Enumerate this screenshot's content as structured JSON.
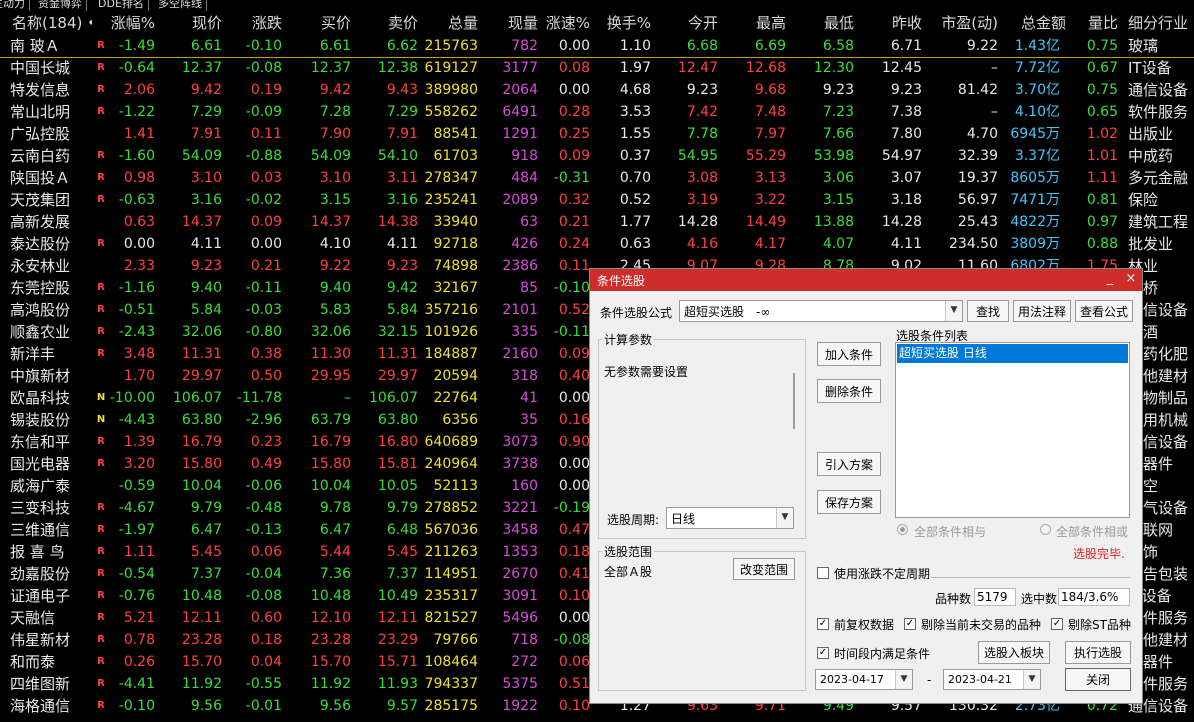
{
  "top_tabs": [
    "主动力",
    "资金博弈",
    "DDE排名",
    "多空阵线"
  ],
  "columns": [
    "名称(184) •",
    "涨幅%",
    "现价",
    "涨跌",
    "买价",
    "卖价",
    "总量",
    "现量",
    "涨速%",
    "换手%",
    "今开",
    "最高",
    "最低",
    "昨收",
    "市盈(动)",
    "总金额",
    "量比",
    "细分行业"
  ],
  "rows": [
    [
      "南 玻Ａ",
      "R",
      "-1.49",
      "6.61",
      "-0.10",
      "6.61",
      "6.62",
      "215763",
      "782",
      "0.00",
      "1.10",
      "6.68",
      "6.69",
      "6.58",
      "6.71",
      "9.22",
      "1.43",
      "亿",
      "0.75",
      "玻璃"
    ],
    [
      "中国长城",
      "R",
      "-0.64",
      "12.37",
      "-0.08",
      "12.37",
      "12.38",
      "619127",
      "3177",
      "0.08",
      "1.97",
      "12.47",
      "12.68",
      "12.30",
      "12.45",
      "–",
      "7.72",
      "亿",
      "0.67",
      "IT设备"
    ],
    [
      "特发信息",
      "R",
      "2.06",
      "9.42",
      "0.19",
      "9.42",
      "9.43",
      "389980",
      "2064",
      "0.00",
      "4.68",
      "9.23",
      "9.68",
      "9.23",
      "9.23",
      "81.42",
      "3.70",
      "亿",
      "0.75",
      "通信设备"
    ],
    [
      "常山北明",
      "R",
      "-1.22",
      "7.29",
      "-0.09",
      "7.28",
      "7.29",
      "558262",
      "6491",
      "0.28",
      "3.53",
      "7.42",
      "7.48",
      "7.23",
      "7.38",
      "–",
      "4.10",
      "亿",
      "0.65",
      "软件服务"
    ],
    [
      "广弘控股",
      "",
      "1.41",
      "7.91",
      "0.11",
      "7.90",
      "7.91",
      "88541",
      "1291",
      "0.25",
      "1.55",
      "7.78",
      "7.97",
      "7.66",
      "7.80",
      "4.70",
      "6945",
      "万",
      "1.02",
      "出版业"
    ],
    [
      "云南白药",
      "R",
      "-1.60",
      "54.09",
      "-0.88",
      "54.09",
      "54.10",
      "61703",
      "918",
      "0.09",
      "0.37",
      "54.95",
      "55.29",
      "53.98",
      "54.97",
      "32.39",
      "3.37",
      "亿",
      "1.01",
      "中成药"
    ],
    [
      "陕国投Ａ",
      "R",
      "0.98",
      "3.10",
      "0.03",
      "3.10",
      "3.11",
      "278347",
      "484",
      "-0.31",
      "0.70",
      "3.08",
      "3.13",
      "3.06",
      "3.07",
      "19.37",
      "8605",
      "万",
      "1.11",
      "多元金融"
    ],
    [
      "天茂集团",
      "R",
      "-0.63",
      "3.16",
      "-0.02",
      "3.15",
      "3.16",
      "235241",
      "2089",
      "0.32",
      "0.52",
      "3.19",
      "3.22",
      "3.15",
      "3.18",
      "56.97",
      "7471",
      "万",
      "0.81",
      "保险"
    ],
    [
      "高新发展",
      "",
      "0.63",
      "14.37",
      "0.09",
      "14.37",
      "14.38",
      "33940",
      "63",
      "0.21",
      "1.77",
      "14.28",
      "14.49",
      "13.88",
      "14.28",
      "25.43",
      "4822",
      "万",
      "0.97",
      "建筑工程"
    ],
    [
      "泰达股份",
      "R",
      "0.00",
      "4.11",
      "0.00",
      "4.10",
      "4.11",
      "92718",
      "426",
      "0.24",
      "0.63",
      "4.16",
      "4.17",
      "4.07",
      "4.11",
      "234.50",
      "3809",
      "万",
      "0.88",
      "批发业"
    ],
    [
      "永安林业",
      "",
      "2.33",
      "9.23",
      "0.21",
      "9.22",
      "9.23",
      "74898",
      "2386",
      "0.11",
      "2.45",
      "9.07",
      "9.28",
      "8.78",
      "9.02",
      "11.60",
      "6802",
      "万",
      "1.75",
      "林业"
    ],
    [
      "东莞控股",
      "R",
      "-1.16",
      "9.40",
      "-0.11",
      "9.40",
      "9.42",
      "32167",
      "85",
      "-0.10",
      "",
      "",
      "",
      "",
      "",
      "",
      "",
      "",
      "",
      "路桥"
    ],
    [
      "高鸿股份",
      "R",
      "-0.51",
      "5.84",
      "-0.03",
      "5.83",
      "5.84",
      "357216",
      "2101",
      "0.52",
      "",
      "",
      "",
      "",
      "",
      "",
      "",
      "",
      "",
      "通信设备"
    ],
    [
      "顺鑫农业",
      "R",
      "-2.43",
      "32.06",
      "-0.80",
      "32.06",
      "32.15",
      "101926",
      "335",
      "-0.11",
      "",
      "",
      "",
      "",
      "",
      "",
      "",
      "",
      "",
      "白酒"
    ],
    [
      "新洋丰",
      "R",
      "3.48",
      "11.31",
      "0.38",
      "11.30",
      "11.31",
      "184887",
      "2160",
      "0.09",
      "",
      "",
      "",
      "",
      "",
      "",
      "",
      "",
      "",
      "农药化肥"
    ],
    [
      "中旗新材",
      "",
      "1.70",
      "29.97",
      "0.50",
      "29.95",
      "29.97",
      "20594",
      "318",
      "0.40",
      "",
      "",
      "",
      "",
      "",
      "",
      "",
      "",
      "",
      "其他建材"
    ],
    [
      "欧晶科技",
      "N",
      "-10.00",
      "106.07",
      "-11.78",
      "–",
      "106.07",
      "22764",
      "41",
      "0.00",
      "",
      "",
      "",
      "",
      "",
      "",
      "",
      "",
      "",
      "矿物制品"
    ],
    [
      "锡装股份",
      "N",
      "-4.43",
      "63.80",
      "-2.96",
      "63.79",
      "63.80",
      "6356",
      "35",
      "0.16",
      "",
      "",
      "",
      "",
      "",
      "",
      "",
      "",
      "",
      "专用机械"
    ],
    [
      "东信和平",
      "R",
      "1.39",
      "16.79",
      "0.23",
      "16.79",
      "16.80",
      "640689",
      "3073",
      "0.90",
      "",
      "",
      "",
      "",
      "",
      "",
      "",
      "",
      "",
      "通信设备"
    ],
    [
      "国光电器",
      "R",
      "3.20",
      "15.80",
      "0.49",
      "15.80",
      "15.81",
      "240964",
      "3738",
      "0.00",
      "",
      "",
      "",
      "",
      "",
      "",
      "",
      "",
      "",
      "元器件"
    ],
    [
      "威海广泰",
      "",
      "-0.59",
      "10.04",
      "-0.06",
      "10.04",
      "10.05",
      "52113",
      "160",
      "0.00",
      "",
      "",
      "",
      "",
      "",
      "",
      "",
      "",
      "",
      "航空"
    ],
    [
      "三变科技",
      "R",
      "-4.67",
      "9.79",
      "-0.48",
      "9.78",
      "9.79",
      "278852",
      "3221",
      "-0.19",
      "",
      "",
      "",
      "",
      "",
      "",
      "",
      "",
      "",
      "电气设备"
    ],
    [
      "三维通信",
      "R",
      "-1.97",
      "6.47",
      "-0.13",
      "6.47",
      "6.48",
      "567036",
      "3458",
      "0.47",
      "",
      "",
      "",
      "",
      "",
      "",
      "",
      "",
      "",
      "互联网"
    ],
    [
      "报 喜 鸟",
      "R",
      "1.11",
      "5.45",
      "0.06",
      "5.44",
      "5.45",
      "211263",
      "1353",
      "0.18",
      "",
      "",
      "",
      "",
      "",
      "",
      "",
      "",
      "",
      "服饰"
    ],
    [
      "劲嘉股份",
      "R",
      "-0.54",
      "7.37",
      "-0.04",
      "7.36",
      "7.37",
      "114951",
      "2670",
      "0.41",
      "",
      "",
      "",
      "",
      "",
      "",
      "",
      "",
      "",
      "广告包装"
    ],
    [
      "证通电子",
      "R",
      "-0.76",
      "10.48",
      "-0.08",
      "10.48",
      "10.49",
      "235317",
      "3091",
      "0.10",
      "",
      "",
      "",
      "",
      "",
      "",
      "",
      "",
      "",
      "IT设备"
    ],
    [
      "天融信",
      "R",
      "5.21",
      "12.11",
      "0.60",
      "12.10",
      "12.11",
      "821527",
      "5496",
      "0.00",
      "",
      "",
      "",
      "",
      "",
      "",
      "",
      "",
      "",
      "软件服务"
    ],
    [
      "伟星新材",
      "R",
      "0.78",
      "23.28",
      "0.18",
      "23.28",
      "23.29",
      "79766",
      "718",
      "-0.08",
      "",
      "",
      "",
      "",
      "",
      "",
      "",
      "",
      "",
      "其他建材"
    ],
    [
      "和而泰",
      "R",
      "0.26",
      "15.70",
      "0.04",
      "15.70",
      "15.71",
      "108464",
      "272",
      "0.06",
      "",
      "",
      "",
      "",
      "",
      "",
      "",
      "",
      "",
      "元器件"
    ],
    [
      "四维图新",
      "R",
      "-4.41",
      "11.92",
      "-0.55",
      "11.92",
      "11.93",
      "794337",
      "5375",
      "0.51",
      "",
      "",
      "",
      "",
      "",
      "",
      "",
      "",
      "",
      "软件服务"
    ],
    [
      "海格通信",
      "R",
      "-0.10",
      "9.56",
      "-0.01",
      "9.56",
      "9.57",
      "285175",
      "1922",
      "0.10",
      "1.27",
      "9.63",
      "9.71",
      "9.49",
      "9.57",
      "130.32",
      "2.73",
      "亿",
      "0.72",
      "通信设备"
    ]
  ],
  "dialog": {
    "title": "条件选股",
    "formula_label": "条件选股公式",
    "formula_value": "超短买选股　-∞",
    "btn_find": "查找",
    "btn_usage": "用法注释",
    "btn_view": "查看公式",
    "params_title": "计算参数",
    "params_text": "无参数需要设置",
    "period_label": "选股周期:",
    "period_value": "日线",
    "btn_add": "加入条件",
    "btn_delete": "删除条件",
    "btn_import": "引入方案",
    "btn_save": "保存方案",
    "list_title": "选股条件列表",
    "list_items": [
      "超短买选股  日线"
    ],
    "radio_and": "全部条件相与",
    "radio_or": "全部条件相或",
    "status": "选股完毕.",
    "range_title": "选股范围",
    "range_value": "全部Ａ股",
    "btn_range": "改变范围",
    "use_period_label": "使用涨跌不定周期",
    "count_label": "品种数",
    "count_value": "5179",
    "selected_label": "选中数",
    "selected_value": "184/3.6%",
    "chk_fq": "前复权数据",
    "chk_exclude_untraded": "剔除当前未交易的品种",
    "chk_exclude_st": "剔除ST品种",
    "chk_time": "时间段内满足条件",
    "btn_to_block": "选股入板块",
    "btn_execute": "执行选股",
    "date_from": "2023-04-17",
    "date_sep": "-",
    "date_to": "2023-04-21",
    "btn_close": "关闭",
    "title_min": "_",
    "title_close": "×"
  },
  "colors": {
    "up": "#ff4040",
    "down": "#3ade3a",
    "neutral": "#e8e8e8",
    "yellow": "#f0e030",
    "magenta": "#d94bd9",
    "cyan": "#40c8ff",
    "accent": "#cf2c2c",
    "list_select": "#0078d7"
  }
}
